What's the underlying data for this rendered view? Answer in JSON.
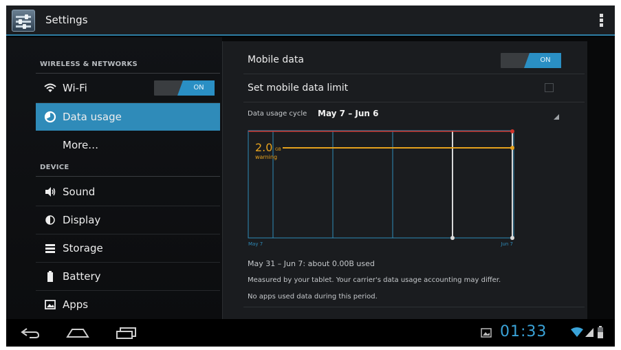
{
  "actionbar": {
    "title": "Settings",
    "app_icon": "settings-icon",
    "overflow": "overflow-menu-icon"
  },
  "sidebar": {
    "sections": [
      {
        "header": "WIRELESS & NETWORKS"
      },
      {
        "header": "DEVICE"
      }
    ],
    "items": [
      {
        "label": "Wi-Fi",
        "icon": "wifi-icon",
        "toggle": "ON"
      },
      {
        "label": "Data usage",
        "icon": "data-usage-icon",
        "selected": true
      },
      {
        "label": "More…"
      },
      {
        "label": "Sound",
        "icon": "speaker-icon"
      },
      {
        "label": "Display",
        "icon": "display-icon"
      },
      {
        "label": "Storage",
        "icon": "storage-icon"
      },
      {
        "label": "Battery",
        "icon": "battery-icon"
      },
      {
        "label": "Apps",
        "icon": "apps-icon"
      }
    ]
  },
  "detail": {
    "mobile_data": {
      "label": "Mobile data",
      "toggle": "ON"
    },
    "limit": {
      "label": "Set mobile data limit",
      "checked": false
    },
    "cycle": {
      "label": "Data usage cycle",
      "value": "May 7 – Jun 6"
    },
    "summary": "May 31 – Jun 7: about 0.00B used",
    "measured": "Measured by your tablet. Your carrier's data usage accounting may differ.",
    "no_apps": "No apps used data during this period."
  },
  "chart_data": {
    "type": "line",
    "x_start_label": "May 7",
    "x_end_label": "Jun 7",
    "warning": {
      "value": "2.0",
      "unit": "GB",
      "label": "warning"
    },
    "colors": {
      "limit": "#d0342c",
      "warning": "#e6a21e",
      "grid": "#2f8bb9",
      "handles": "#d8d8d8"
    }
  },
  "navbar": {
    "back": "back-icon",
    "home": "home-icon",
    "recents": "recent-apps-icon",
    "clock": "01:33",
    "status_icons": [
      "gallery-notification-icon",
      "wifi-signal-icon",
      "cell-signal-icon",
      "battery-status-icon"
    ]
  },
  "colors": {
    "accent": "#2f8bb9",
    "clock": "#3aa3d8"
  }
}
